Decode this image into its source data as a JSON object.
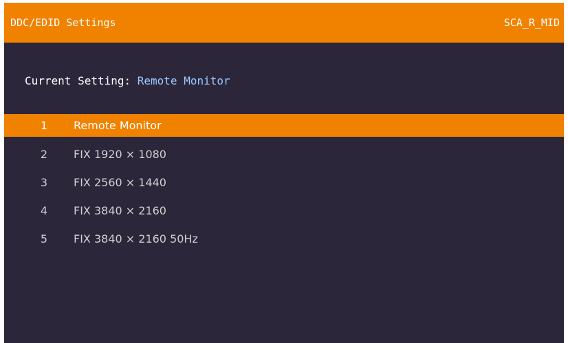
{
  "header": {
    "title": "DDC/EDID Settings",
    "device_id": "SCA_R_MID"
  },
  "current": {
    "label": "Current Setting: ",
    "value": "Remote Monitor"
  },
  "menu": {
    "selected_index": 0,
    "items": [
      {
        "index": "1",
        "label": "Remote Monitor"
      },
      {
        "index": "2",
        "label": "FIX 1920 × 1080"
      },
      {
        "index": "3",
        "label": "FIX 2560 × 1440"
      },
      {
        "index": "4",
        "label": "FIX 3840 × 2160"
      },
      {
        "index": "5",
        "label": "FIX 3840 × 2160 50Hz"
      }
    ]
  },
  "colors": {
    "accent": "#f08200",
    "background": "#2b263a",
    "current_value": "#9fc8ff",
    "item_text": "#d0d0d0"
  }
}
